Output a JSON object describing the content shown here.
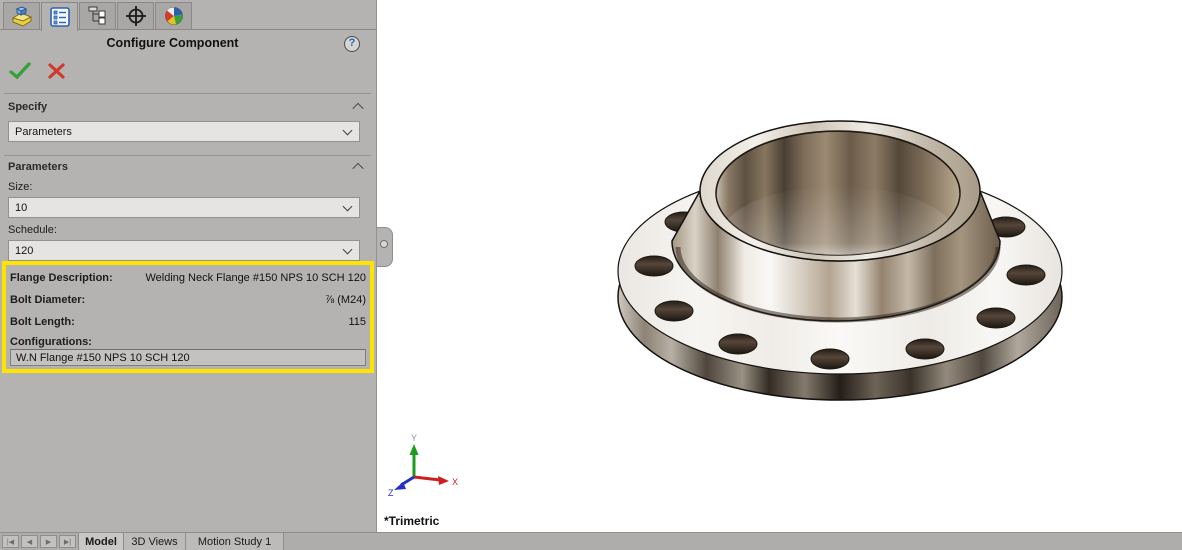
{
  "colors": {
    "highlight": "#ffe400",
    "ok_green": "#35a23c",
    "cancel_red": "#cf3a2c",
    "help_blue": "#1f6bb5",
    "panel_gray": "#b4b3b2"
  },
  "panel": {
    "tabs": [
      {
        "name": "feature-manager",
        "icon": "part-icon",
        "active": false
      },
      {
        "name": "property-manager",
        "icon": "property-list-icon",
        "active": true
      },
      {
        "name": "configuration-manager",
        "icon": "configuration-tree-icon",
        "active": false
      },
      {
        "name": "dimxpert-manager",
        "icon": "target-icon",
        "active": false
      },
      {
        "name": "display-manager",
        "icon": "display-sphere-icon",
        "active": false
      }
    ],
    "title": "Configure Component",
    "help_label": "?",
    "specify": {
      "label": "Specify",
      "value": "Parameters"
    },
    "parameters": {
      "label": "Parameters",
      "size_label": "Size:",
      "size_value": "10",
      "schedule_label": "Schedule:",
      "schedule_value": "120"
    },
    "details": {
      "rows": [
        {
          "label": "Flange Description:",
          "value": "Welding Neck Flange #150 NPS 10 SCH 120"
        },
        {
          "label": "Bolt Diameter:",
          "value": "⅞ (M24)"
        },
        {
          "label": "Bolt Length:",
          "value": "115"
        }
      ],
      "configurations_label": "Configurations:",
      "configurations_value": "W.N Flange #150 NPS 10 SCH 120"
    }
  },
  "viewport": {
    "view_label": "*Trimetric",
    "triad": {
      "x": "X",
      "y": "Y",
      "z": "Z"
    }
  },
  "bottom_bar": {
    "nav": {
      "first": "|◀",
      "prev": "◀",
      "next": "▶",
      "last": "▶|"
    },
    "tabs": [
      {
        "label": "Model",
        "active": true
      },
      {
        "label": "3D Views",
        "active": false
      },
      {
        "label": "Motion Study 1",
        "active": false
      }
    ]
  }
}
